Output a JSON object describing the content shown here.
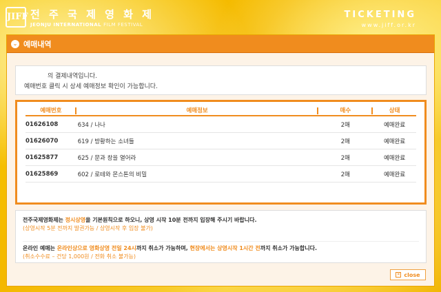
{
  "header": {
    "logo": "JIFF",
    "title_plain": "전 주 국 제 ",
    "title_accent": "영 화 제",
    "subtitle_bold": "JEONJU INTERNATIONAL ",
    "subtitle_light": "FILM FESTIVAL",
    "right_title": "TICKETING",
    "url": "www.jiff.or.kr"
  },
  "panel": {
    "title": "예매내역",
    "chevron": "⌄"
  },
  "notice": {
    "line1": "의 결제내역입니다.",
    "line2": "예매번호 클릭 시 상세 예매정보 확인이 가능합니다."
  },
  "table": {
    "headers": [
      "예매번호",
      "예매정보",
      "매수",
      "상태"
    ],
    "rows": [
      {
        "id": "01626108",
        "info": "634 / 나나",
        "qty": "2매",
        "status": "예매완료"
      },
      {
        "id": "01626070",
        "info": "619 / 방황하는 소녀들",
        "qty": "2매",
        "status": "예매완료"
      },
      {
        "id": "01625877",
        "info": "625 / 문과 창을 열어라",
        "qty": "2매",
        "status": "예매완료"
      },
      {
        "id": "01625869",
        "info": "602 / 로테와 몬스톤의 비밀",
        "qty": "2매",
        "status": "예매완료"
      }
    ]
  },
  "info": {
    "p1_a": "전주국제영화제는 ",
    "p1_hl": "정시상영",
    "p1_b": "을 기본원칙으로 하오니, 상영 시작 10분 전까지 입장해 주시기 바랍니다.",
    "p1_note": "(상영시작 5분 전까지 발권가능 / 상영시작 후 입장 불가)",
    "p2_a": "온라인 예매는 ",
    "p2_hl1": "온라인상으로 영화상영 전일 24시",
    "p2_b": "까지 취소가 가능하며, ",
    "p2_hl2": "현장에서는 상영시작 1시간 전",
    "p2_c": "까지 취소가 가능합니다.",
    "p2_note": "(취소수수료 – 건당 1,000원 / 전화 취소 불가능)"
  },
  "close": {
    "icon": "✕",
    "label": "close"
  }
}
